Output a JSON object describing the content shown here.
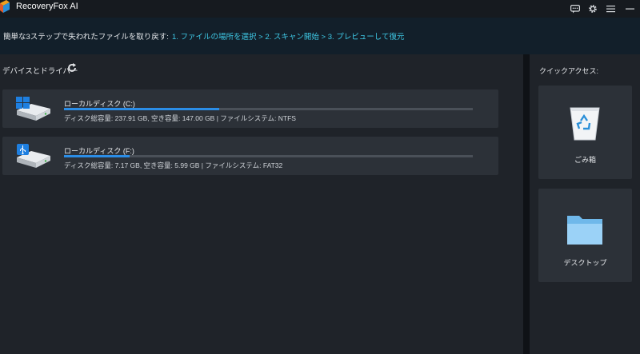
{
  "window": {
    "title": "RecoveryFox AI",
    "controls": [
      "feedback-icon",
      "gear-icon",
      "menu-icon",
      "minimize-icon"
    ]
  },
  "banner": {
    "intro": "簡単な3ステップで失われたファイルを取り戻す:",
    "steps": "1. ファイルの場所を選択 > 2. スキャン開始 > 3. プレビューして復元"
  },
  "devices": {
    "title": "デバイスとドライバー",
    "drives": [
      {
        "name": "ローカルディスク (C:)",
        "info": "ディスク総容量: 237.91 GB, 空き容量: 147.00 GB | ファイルシステム: NTFS",
        "used_fraction": 0.38,
        "icon": "windows-drive-icon"
      },
      {
        "name": "ローカルディスク (F:)",
        "info": "ディスク総容量: 7.17 GB, 空き容量: 5.99 GB | ファイルシステム: FAT32",
        "used_fraction": 0.16,
        "icon": "usb-drive-icon"
      }
    ]
  },
  "quick_access": {
    "title": "クイックアクセス:",
    "items": [
      {
        "label": "ごみ箱",
        "icon": "recycle-bin-icon"
      },
      {
        "label": "デスクトップ",
        "icon": "folder-icon"
      }
    ]
  },
  "colors": {
    "accent": "#2b8de6",
    "steps_text": "#3fc9e6",
    "card_bg": "#2c3138",
    "panel_bg": "#1f2329"
  }
}
